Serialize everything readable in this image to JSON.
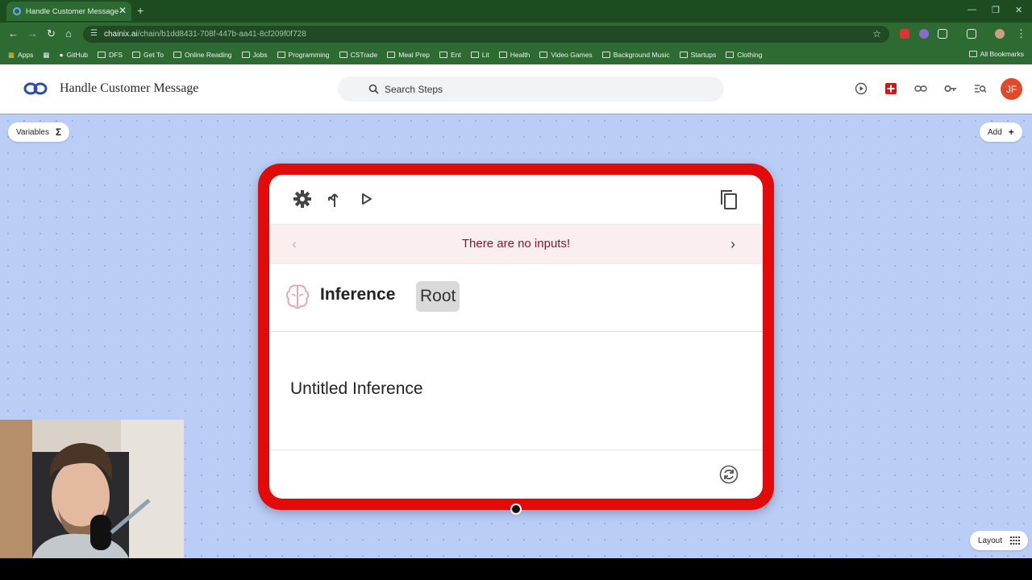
{
  "browser": {
    "tab_title": "Handle Customer Message",
    "url_host": "chainix.ai",
    "url_path": "/chain/b1dd8431-708f-447b-aa41-8cf209f0f728",
    "bookmarks": [
      "Apps",
      "GitHub",
      "DFS",
      "Get To",
      "Online Reading",
      "Jobs",
      "Programming",
      "CSTrade",
      "Meal Prep",
      "Ent",
      "Lit",
      "Health",
      "Video Games",
      "Background Music",
      "Startups",
      "Clothing"
    ],
    "all_bookmarks": "All Bookmarks"
  },
  "app": {
    "title": "Handle Customer Message",
    "search_placeholder": "Search Steps",
    "avatar_initials": "JF",
    "variables_label": "Variables",
    "variables_glyph": "Σ",
    "add_label": "Add",
    "add_glyph": "+",
    "layout_label": "Layout"
  },
  "node": {
    "inputs_message": "There are no inputs!",
    "type_label": "Inference",
    "badge": "Root",
    "name": "Untitled Inference",
    "border_color": "#e30a0a"
  },
  "colors": {
    "canvas": "#b9cdf6",
    "browser_chrome": "#2e6b33",
    "avatar": "#e2492b"
  }
}
